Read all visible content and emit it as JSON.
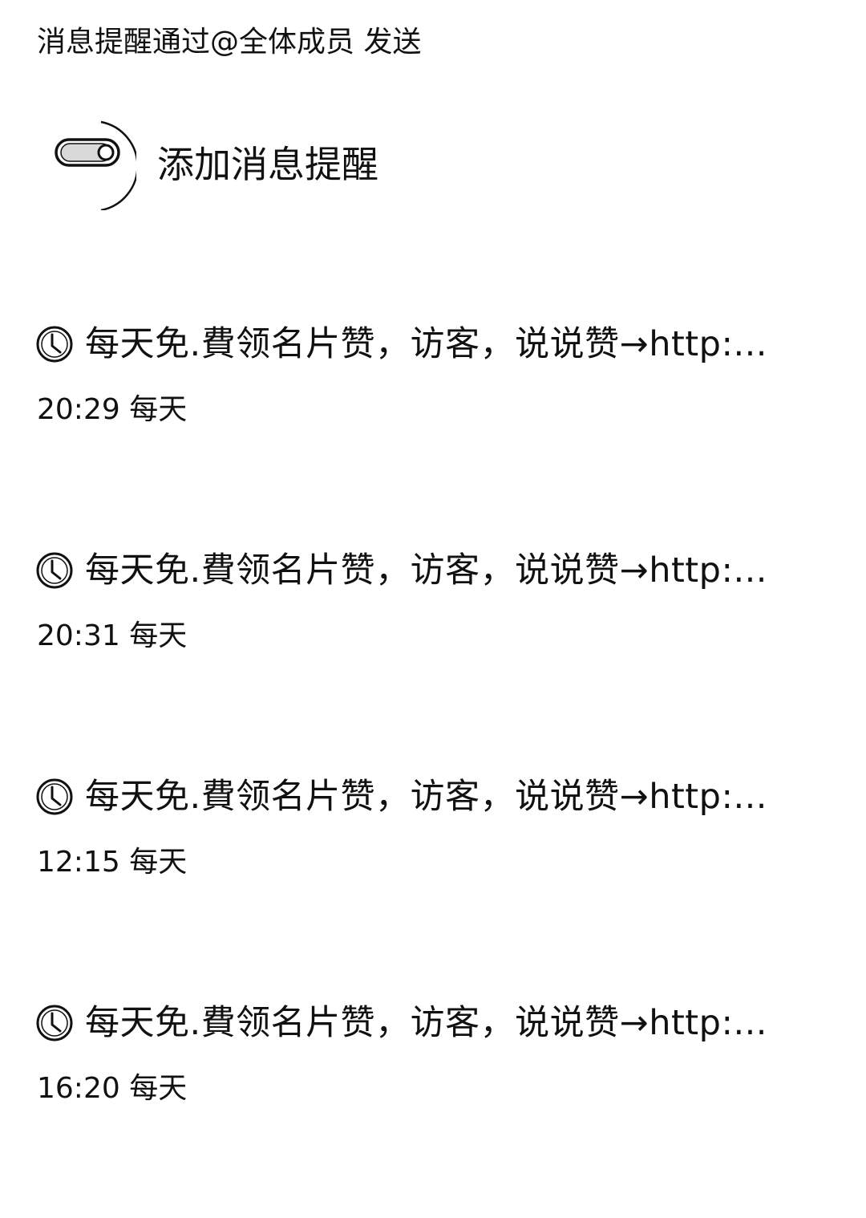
{
  "header": {
    "note": "消息提醒通过@全体成员 发送"
  },
  "add_reminder": {
    "label": "添加消息提醒",
    "icon": "toggle-switch-icon"
  },
  "reminders": [
    {
      "icon": "clock-icon",
      "text": "每天免.費领名片赞，访客，说说赞→http:...",
      "time": "20:29",
      "repeat": "每天"
    },
    {
      "icon": "clock-icon",
      "text": "每天免.費领名片赞，访客，说说赞→http:...",
      "time": "20:31",
      "repeat": "每天"
    },
    {
      "icon": "clock-icon",
      "text": "每天免.費领名片赞，访客，说说赞→http:...",
      "time": "12:15",
      "repeat": "每天"
    },
    {
      "icon": "clock-icon",
      "text": "每天免.費领名片赞，访客，说说赞→http:...",
      "time": "16:20",
      "repeat": "每天"
    }
  ],
  "colors": {
    "text": "#111111",
    "background": "#ffffff"
  }
}
